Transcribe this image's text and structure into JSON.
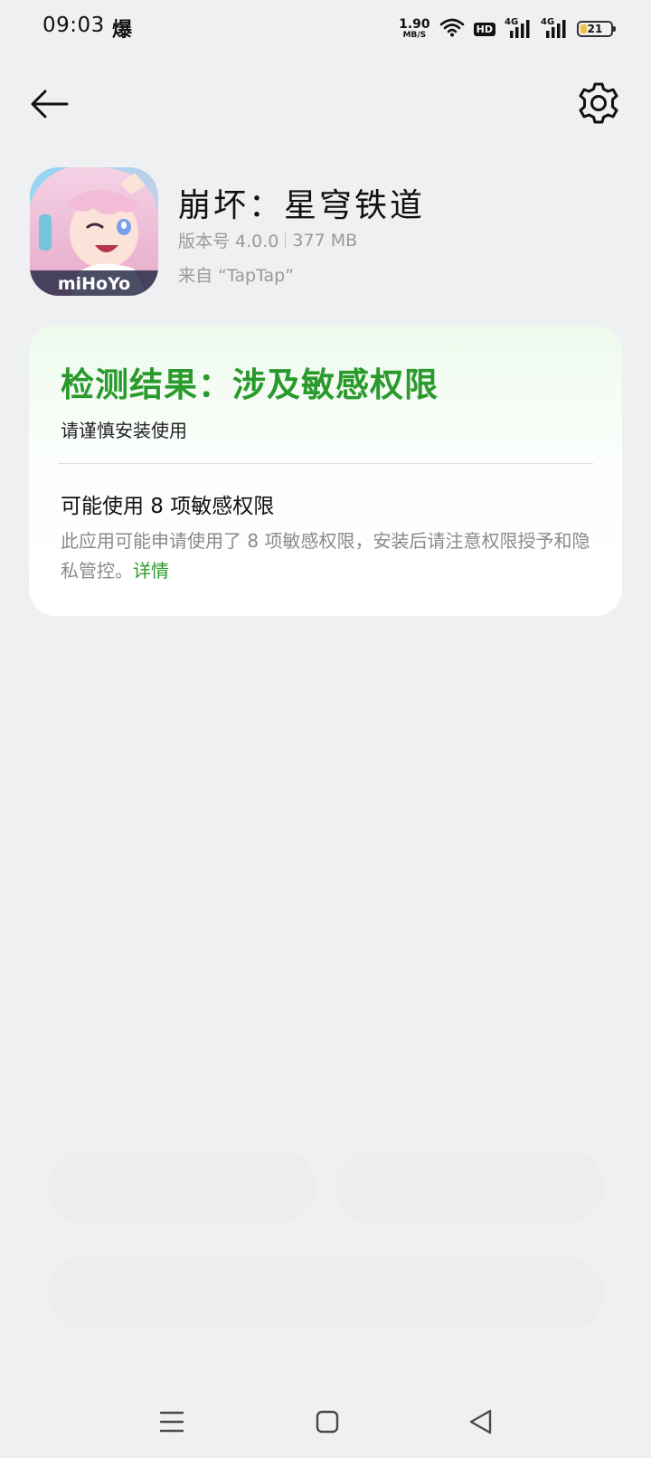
{
  "status_bar": {
    "time": "09:03",
    "carrier_glyph": "爆",
    "net_speed_value": "1.90",
    "net_speed_unit": "MB/S",
    "hd_label": "HD",
    "signal_1_label": "4G",
    "signal_2_label": "4G",
    "battery_level": "21",
    "battery_fill_color": "#f1c24b"
  },
  "nav": {
    "back_icon": "arrow-left-icon",
    "settings_icon": "gear-icon"
  },
  "app": {
    "name": "崩坏：星穹铁道",
    "version": "版本号 4.0.0",
    "size": "377 MB",
    "source": "来自 “TapTap”",
    "icon_brand_text": "miHoYo"
  },
  "result": {
    "title": "检测结果：涉及敏感权限",
    "subtitle": "请谨慎安装使用",
    "permission_heading": "可能使用 8 项敏感权限",
    "permission_description": "此应用可能申请使用了 8 项敏感权限，安装后请注意权限授予和隐私管控。",
    "details_link": "详情",
    "accent_color": "#2a9a2c"
  },
  "actions": {
    "left_button": "",
    "right_button": "",
    "wide_button": ""
  },
  "navbar": {
    "menu_icon": "menu-icon",
    "home_icon": "square-home-icon",
    "back_icon": "triangle-back-icon"
  }
}
